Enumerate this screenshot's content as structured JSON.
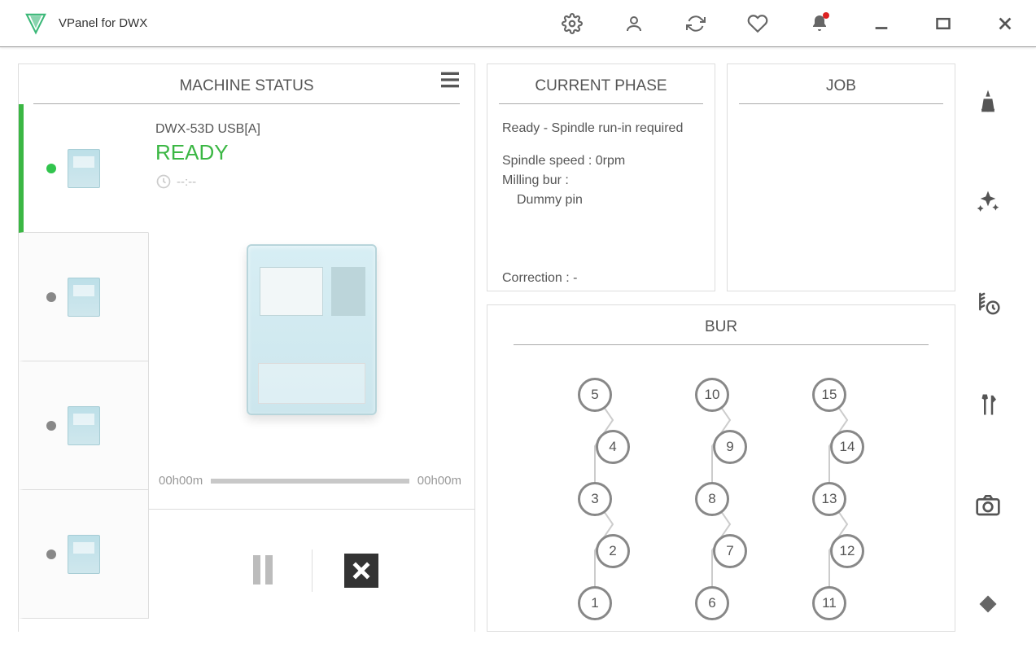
{
  "titlebar": {
    "title": "VPanel for DWX"
  },
  "machine_status": {
    "header": "MACHINE STATUS",
    "device_name": "DWX-53D USB[A]",
    "state": "READY",
    "elapsed_placeholder": "--:--",
    "progress_start": "00h00m",
    "progress_end": "00h00m"
  },
  "current_phase": {
    "header": "CURRENT PHASE",
    "line1": "Ready - Spindle run-in required",
    "spindle": "Spindle speed : 0rpm",
    "milling_label": "Milling bur :",
    "milling_value": "Dummy pin",
    "correction": "Correction : -"
  },
  "job": {
    "header": "JOB"
  },
  "bur": {
    "header": "BUR",
    "columns": [
      [
        "5",
        "4",
        "3",
        "2",
        "1"
      ],
      [
        "10",
        "9",
        "8",
        "7",
        "6"
      ],
      [
        "15",
        "14",
        "13",
        "12",
        "11"
      ]
    ]
  }
}
